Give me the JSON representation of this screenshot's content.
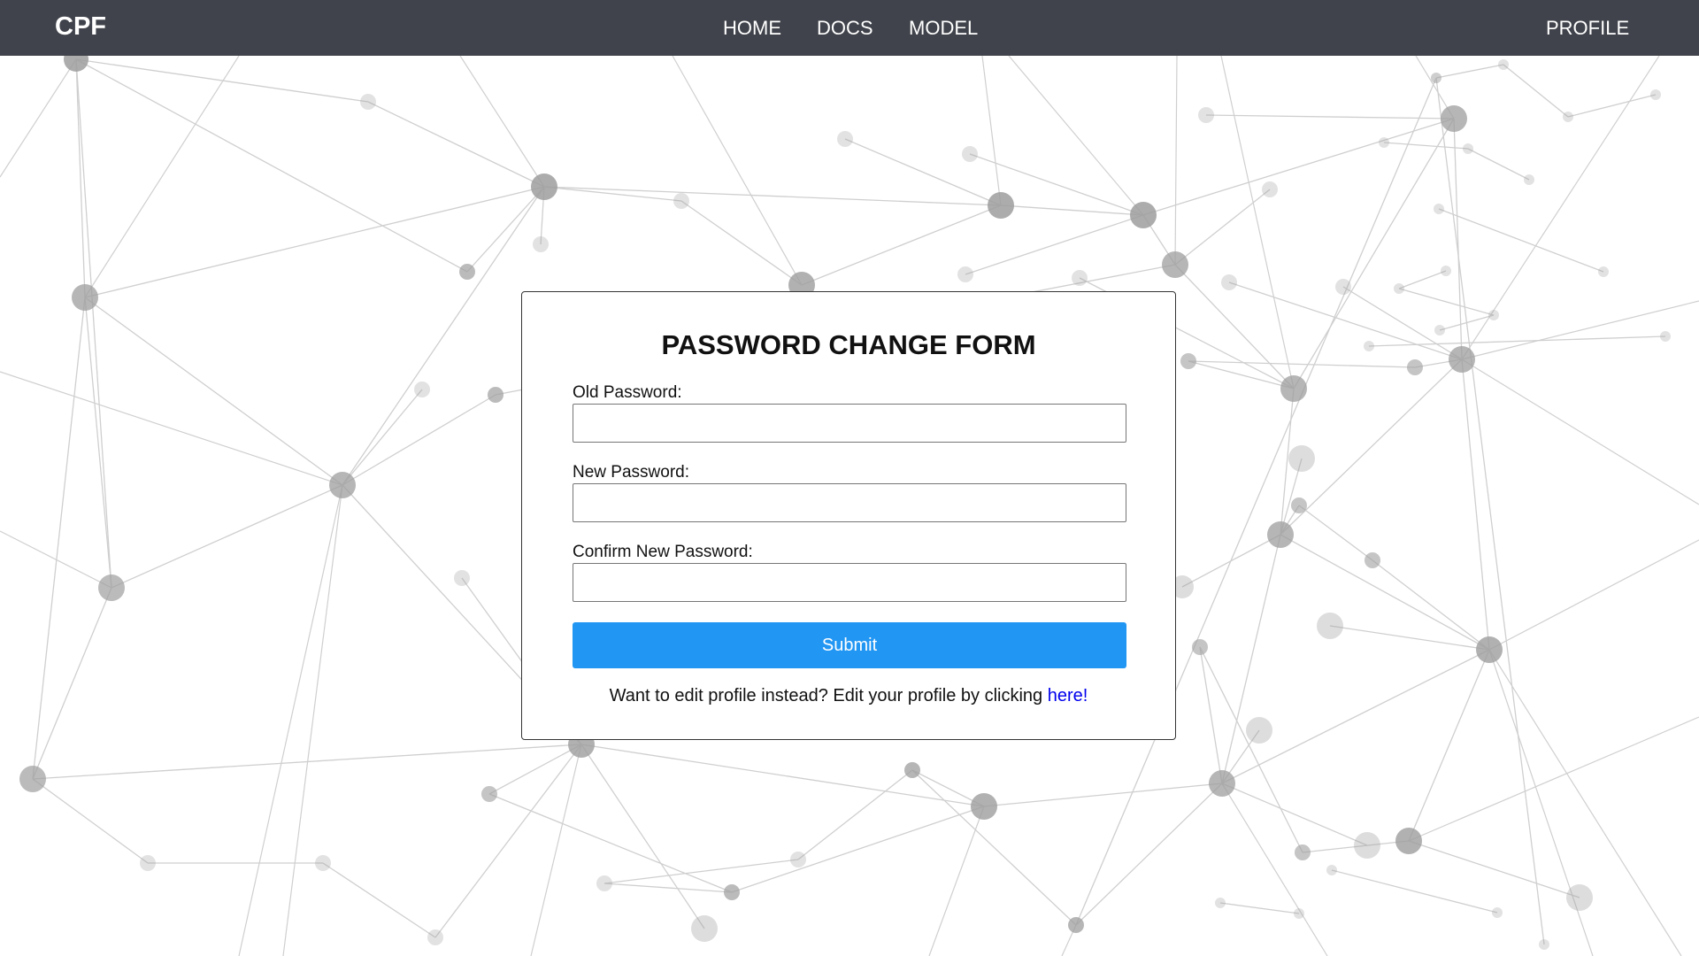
{
  "navbar": {
    "brand": "CPF",
    "links": {
      "home": "HOME",
      "docs": "DOCS",
      "model": "MODEL",
      "profile": "PROFILE"
    },
    "background_color": "#40434b"
  },
  "form": {
    "title": "PASSWORD CHANGE FORM",
    "fields": {
      "old_password": {
        "label": "Old Password:",
        "value": ""
      },
      "new_password": {
        "label": "New Password:",
        "value": ""
      },
      "confirm_password": {
        "label": "Confirm New Password:",
        "value": ""
      }
    },
    "submit_label": "Submit",
    "submit_color": "#2196f3",
    "footer_text": "Want to edit profile instead? Edit your profile by clicking ",
    "footer_link": "here!"
  },
  "background": {
    "pattern": "network-nodes",
    "node_color": "#9e9e9e",
    "line_color": "#cfcfcf"
  }
}
